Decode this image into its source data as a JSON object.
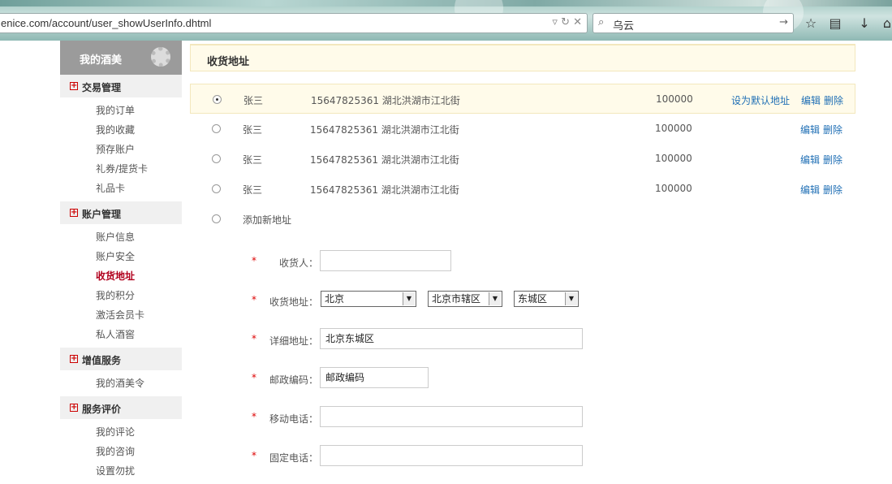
{
  "browser": {
    "url": "enice.com/account/user_showUserInfo.dhtml",
    "search_term": "乌云"
  },
  "sidebar": {
    "title": "我的酒美",
    "groups": [
      {
        "label": "交易管理",
        "items": [
          "我的订单",
          "我的收藏",
          "预存账户",
          "礼券/提货卡",
          "礼品卡"
        ]
      },
      {
        "label": "账户管理",
        "items": [
          "账户信息",
          "账户安全",
          "收货地址",
          "我的积分",
          "激活会员卡",
          "私人酒窖"
        ]
      },
      {
        "label": "增值服务",
        "items": [
          "我的酒美令"
        ]
      },
      {
        "label": "服务评价",
        "items": [
          "我的评论",
          "我的咨询",
          "设置勿扰"
        ]
      }
    ],
    "active_item": "收货地址"
  },
  "main": {
    "title": "收货地址",
    "addresses": [
      {
        "name": "张三",
        "phone_address": "15647825361 湖北洪湖市江北街",
        "zip": "100000",
        "set_default": "设为默认地址",
        "edit": "编辑",
        "delete": "删除",
        "selected": true
      },
      {
        "name": "张三",
        "phone_address": "15647825361 湖北洪湖市江北街",
        "zip": "100000",
        "set_default": "",
        "edit": "编辑",
        "delete": "删除",
        "selected": false
      },
      {
        "name": "张三",
        "phone_address": "15647825361 湖北洪湖市江北街",
        "zip": "100000",
        "set_default": "",
        "edit": "编辑",
        "delete": "删除",
        "selected": false
      },
      {
        "name": "张三",
        "phone_address": "15647825361 湖北洪湖市江北街",
        "zip": "100000",
        "set_default": "",
        "edit": "编辑",
        "delete": "删除",
        "selected": false
      }
    ],
    "add_new_label": "添加新地址",
    "form": {
      "required_mark": "*",
      "receiver_label": "收货人：",
      "receiver_value": "",
      "address_label": "收货地址：",
      "province": "北京",
      "city": "北京市辖区",
      "district": "东城区",
      "detail_label": "详细地址：",
      "detail_value": "北京东城区",
      "zip_label": "邮政编码：",
      "zip_value": "邮政编码",
      "mobile_label": "移动电话：",
      "mobile_value": "",
      "phone_label": "固定电话：",
      "phone_value": ""
    }
  }
}
